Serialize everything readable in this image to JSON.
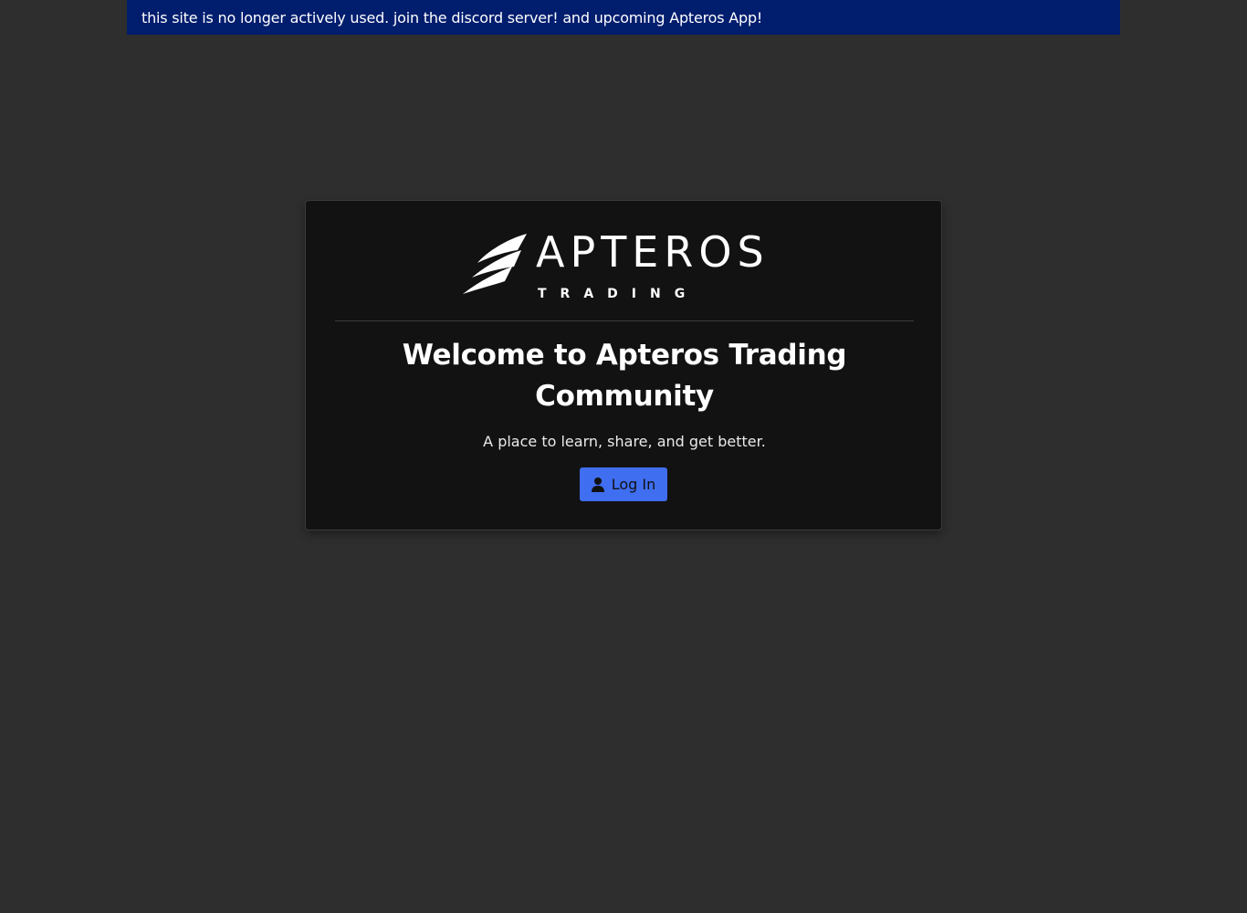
{
  "banner": {
    "text": "this site is no longer actively used. join the discord server! and upcoming Apteros App!",
    "color": "#001d6e"
  },
  "logo": {
    "wordmark": "APTEROS",
    "tagline": "TRADING",
    "icon": "wing-icon"
  },
  "card": {
    "title": "Welcome to Apteros Trading Community",
    "subtitle": "A place to learn, share, and get better."
  },
  "login": {
    "label": "Log In",
    "icon": "user-icon",
    "color": "#3f6ef0"
  }
}
